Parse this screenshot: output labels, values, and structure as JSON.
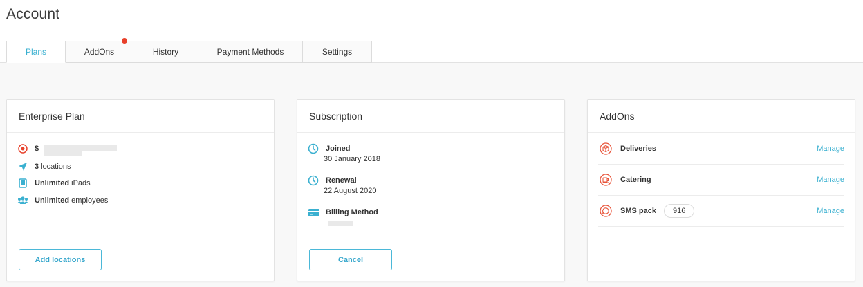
{
  "page": {
    "title": "Account"
  },
  "tabs": [
    {
      "label": "Plans",
      "active": true
    },
    {
      "label": "AddOns",
      "notification": true
    },
    {
      "label": "History"
    },
    {
      "label": "Payment Methods"
    },
    {
      "label": "Settings"
    }
  ],
  "plan_card": {
    "title": "Enterprise Plan",
    "price_prefix": "$",
    "locations_count": "3",
    "locations_label": "locations",
    "ipads_value": "Unlimited",
    "ipads_label": "iPads",
    "employees_value": "Unlimited",
    "employees_label": "employees",
    "button_label": "Add locations"
  },
  "subscription_card": {
    "title": "Subscription",
    "joined_label": "Joined",
    "joined_date": "30 January 2018",
    "renewal_label": "Renewal",
    "renewal_date": "22 August 2020",
    "billing_label": "Billing Method",
    "button_label": "Cancel"
  },
  "addons_card": {
    "title": "AddOns",
    "items": [
      {
        "name": "Deliveries",
        "icon": "box-icon",
        "action": "Manage"
      },
      {
        "name": "Catering",
        "icon": "catering-icon",
        "action": "Manage"
      },
      {
        "name": "SMS pack",
        "icon": "chat-icon",
        "count": "916",
        "action": "Manage"
      }
    ]
  },
  "colors": {
    "accent": "#3ab0d0",
    "alert": "#e8402a",
    "addon_icon": "#e8543a",
    "sub_icon": "#3ab0d0"
  }
}
